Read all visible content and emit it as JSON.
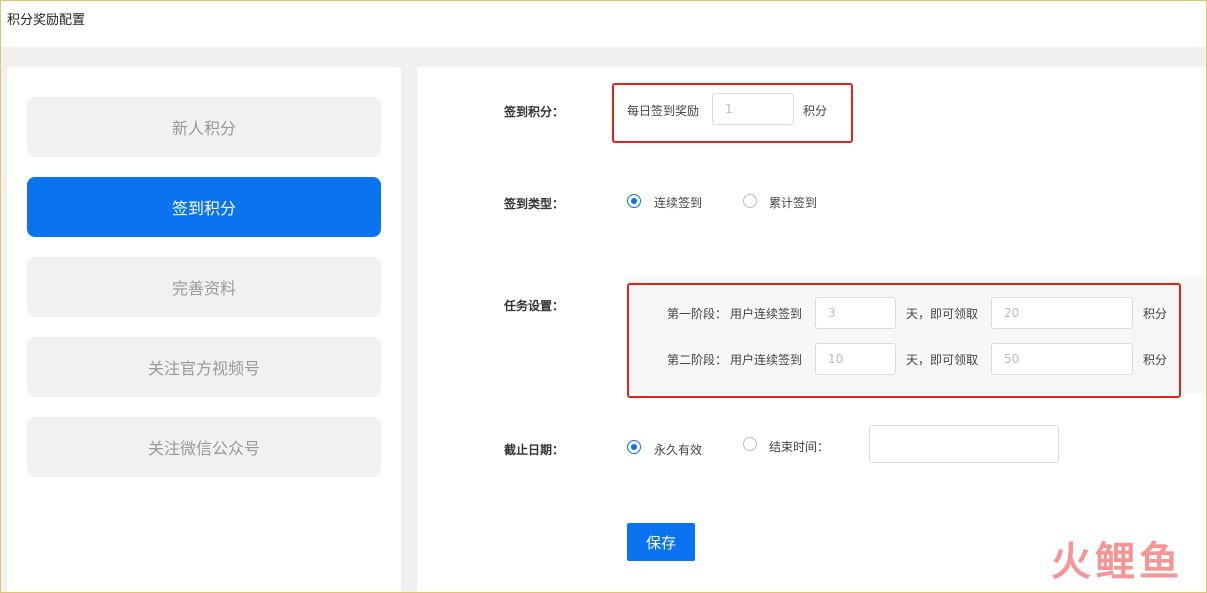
{
  "page": {
    "title": "积分奖励配置"
  },
  "sidebar": {
    "items": [
      {
        "label": "新人积分",
        "active": false
      },
      {
        "label": "签到积分",
        "active": true
      },
      {
        "label": "完善资料",
        "active": false
      },
      {
        "label": "关注官方视频号",
        "active": false
      },
      {
        "label": "关注微信公众号",
        "active": false
      }
    ]
  },
  "form": {
    "signin_points": {
      "label": "签到积分：",
      "prefix": "每日签到奖励",
      "value": "1",
      "unit": "积分"
    },
    "signin_type": {
      "label": "签到类型：",
      "options": [
        {
          "label": "连续签到",
          "selected": true
        },
        {
          "label": "累计签到",
          "selected": false
        }
      ]
    },
    "tasks": {
      "label": "任务设置：",
      "stages": [
        {
          "name": "第一阶段：",
          "days_label": "用户连续签到",
          "days": "3",
          "mid": "天，即可领取",
          "points": "20",
          "unit": "积分"
        },
        {
          "name": "第二阶段：",
          "days_label": "用户连续签到",
          "days": "10",
          "mid": "天，即可领取",
          "points": "50",
          "unit": "积分"
        }
      ]
    },
    "deadline": {
      "label": "截止日期：",
      "options": [
        {
          "label": "永久有效",
          "selected": true
        },
        {
          "label": "结束时间：",
          "selected": false
        }
      ],
      "end_time": ""
    },
    "save_label": "保存"
  },
  "watermark": {
    "text": "火鲤鱼"
  },
  "colors": {
    "accent": "#0a73f0",
    "highlight": "#e0231b"
  }
}
